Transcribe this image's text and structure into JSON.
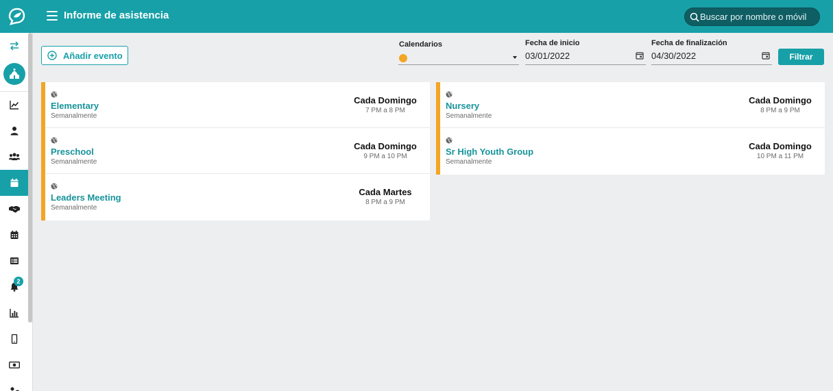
{
  "header": {
    "title": "Informe de asistencia",
    "search_placeholder": "Buscar por nombre o móvil",
    "accent_color": "#17a0a8"
  },
  "sidebar": {
    "items": [
      {
        "icon": "swap-arrows-icon"
      },
      {
        "icon": "church-icon"
      },
      {
        "icon": "line-chart-icon"
      },
      {
        "icon": "person-icon"
      },
      {
        "icon": "group-icon"
      },
      {
        "icon": "calendar-icon",
        "active": true
      },
      {
        "icon": "handshake-icon"
      },
      {
        "icon": "calendar-grid-icon"
      },
      {
        "icon": "list-icon"
      },
      {
        "icon": "bell-icon",
        "badge": "2"
      },
      {
        "icon": "bar-chart-icon"
      },
      {
        "icon": "mobile-icon"
      },
      {
        "icon": "money-icon"
      },
      {
        "icon": "users-gear-icon"
      }
    ]
  },
  "toolbar": {
    "add_event_label": "Añadir evento",
    "calendars_label": "Calendarios",
    "calendar_color": "#f2a623",
    "start_date_label": "Fecha de inicio",
    "start_date_value": "03/01/2022",
    "end_date_label": "Fecha de finalización",
    "end_date_value": "04/30/2022",
    "filter_label": "Filtrar"
  },
  "events_left": [
    {
      "name": "Elementary",
      "frequency": "Semanalmente",
      "when": "Cada Domingo",
      "time": "7 PM a 8 PM"
    },
    {
      "name": "Preschool",
      "frequency": "Semanalmente",
      "when": "Cada Domingo",
      "time": "9 PM a 10 PM"
    },
    {
      "name": "Leaders Meeting",
      "frequency": "Semanalmente",
      "when": "Cada Martes",
      "time": "8 PM a 9 PM"
    }
  ],
  "events_right": [
    {
      "name": "Nursery",
      "frequency": "Semanalmente",
      "when": "Cada Domingo",
      "time": "8 PM a 9 PM"
    },
    {
      "name": "Sr High Youth Group",
      "frequency": "Semanalmente",
      "when": "Cada Domingo",
      "time": "10 PM a 11 PM"
    }
  ]
}
